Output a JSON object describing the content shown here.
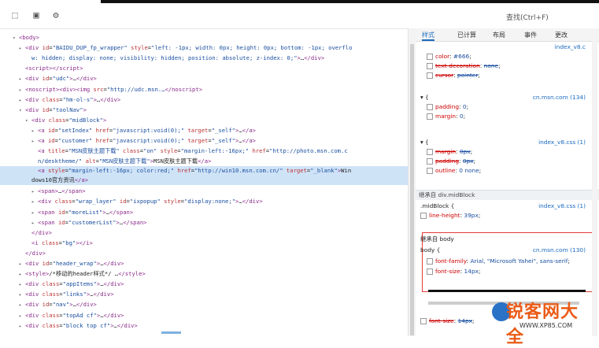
{
  "toolbar": {
    "search_placeholder": "查找(Ctrl+F)",
    "icons": [
      "inspect-icon",
      "console-toggle-icon",
      "settings-icon"
    ]
  },
  "dom_lines": [
    {
      "indent": 2,
      "t": "▾",
      "html": "<span class='tag'>&lt;body&gt;</span>"
    },
    {
      "indent": 3,
      "t": "▸",
      "html": "<span class='tag'>&lt;div</span> <span class='attr'>id</span>=<span class='val'>\"BAIDU_DUP_fp_wrapper\"</span> <span class='attr'>style</span>=<span class='val'>\"left: -1px; width: 0px; height: 0px; bottom: -1px; overflo</span>"
    },
    {
      "indent": 4,
      "t": "",
      "html": "<span class='val'>w: hidden; display: none; visibility: hidden; position: absolute; z-index: 0;\"</span><span class='tag'>&gt;</span>…<span class='tag'>&lt;/div&gt;</span>"
    },
    {
      "indent": 3,
      "t": "",
      "html": "<span class='tag'>&lt;script&gt;&lt;/script&gt;</span>"
    },
    {
      "indent": 3,
      "t": "▸",
      "html": "<span class='tag'>&lt;div</span> <span class='attr'>id</span>=<span class='val'>\"udc\"</span><span class='tag'>&gt;</span>…<span class='tag'>&lt;/div&gt;</span>"
    },
    {
      "indent": 3,
      "t": "▸",
      "html": "<span class='tag'>&lt;noscript&gt;&lt;div&gt;&lt;img</span> <span class='attr'>src</span>=<span class='val'>\"http://udc.msn.…</span><span class='tag'>&lt;/noscript&gt;</span>"
    },
    {
      "indent": 3,
      "t": "▸",
      "html": "<span class='tag'>&lt;div</span> <span class='attr'>class</span>=<span class='val'>\"hm-ol-s\"</span><span class='tag'>&gt;</span>…<span class='tag'>&lt;/div&gt;</span>"
    },
    {
      "indent": 3,
      "t": "▾",
      "html": "<span class='tag'>&lt;div</span> <span class='attr'>id</span>=<span class='val'>\"toolNav\"</span><span class='tag'>&gt;</span>"
    },
    {
      "indent": 4,
      "t": "▾",
      "html": "<span class='tag'>&lt;div</span> <span class='attr'>class</span>=<span class='val'>\"midBlock\"</span><span class='tag'>&gt;</span>"
    },
    {
      "indent": 5,
      "t": "▸",
      "html": "<span class='tag'>&lt;a</span> <span class='attr'>id</span>=<span class='val'>\"setIndex\"</span> <span class='attr'>href</span>=<span class='val'>\"javascript:void(0);\"</span> <span class='attr'>target</span>=<span class='val'>\"_self\"</span><span class='tag'>&gt;</span>…<span class='tag'>&lt;/a&gt;</span>"
    },
    {
      "indent": 5,
      "t": "▸",
      "html": "<span class='tag'>&lt;a</span> <span class='attr'>id</span>=<span class='val'>\"customer\"</span> <span class='attr'>href</span>=<span class='val'>\"javascript:void(0);\"</span> <span class='attr'>target</span>=<span class='val'>\"_self\"</span><span class='tag'>&gt;</span>…<span class='tag'>&lt;/a&gt;</span>"
    },
    {
      "indent": 5,
      "t": "",
      "html": "<span class='tag'>&lt;a</span> <span class='attr'>title</span>=<span class='val'>\"MSN皮肤主题下载\"</span> <span class='attr'>class</span>=<span class='val'>\"on\"</span> <span class='attr'>style</span>=<span class='val'>\"margin-left:-16px;\"</span> <span class='attr'>href</span>=<span class='val'>\"http://photo.msn.com.c</span>"
    },
    {
      "indent": 5,
      "t": "",
      "html": "<span class='val'>n/desktheme/\"</span> <span class='attr'>alt</span>=<span class='val'>\"MSN皮肤主题下载\"</span><span class='tag'>&gt;</span>MSN皮肤主题下载<span class='tag'>&lt;/a&gt;</span>"
    },
    {
      "indent": 5,
      "t": "",
      "sel": true,
      "html": "<span class='tag'>&lt;a</span> <span class='attr'>style</span>=<span class='val'>\"margin-left:-16px; color:red;\"</span> <span class='attr'>href</span>=<span class='val'>\"http://win10.msn.com.cn/\"</span> <span class='attr'>target</span>=<span class='val'>\"_blank\"</span><span class='tag'>&gt;</span>Win<br>dows10官方资讯<span class='tag'>&lt;/a&gt;</span>"
    },
    {
      "indent": 5,
      "t": "▸",
      "html": "<span class='tag'>&lt;span&gt;</span>…<span class='tag'>&lt;/span&gt;</span>"
    },
    {
      "indent": 5,
      "t": "▸",
      "html": "<span class='tag'>&lt;div</span> <span class='attr'>class</span>=<span class='val'>\"wrap_layer\"</span> <span class='attr'>id</span>=<span class='val'>\"ixpopup\"</span> <span class='attr'>style</span>=<span class='val'>\"display:none;\"</span><span class='tag'>&gt;</span>…<span class='tag'>&lt;/div&gt;</span>"
    },
    {
      "indent": 5,
      "t": "▸",
      "html": "<span class='tag'>&lt;span</span> <span class='attr'>id</span>=<span class='val'>\"moreList\"</span><span class='tag'>&gt;</span>…<span class='tag'>&lt;/span&gt;</span>"
    },
    {
      "indent": 5,
      "t": "▸",
      "html": "<span class='tag'>&lt;span</span> <span class='attr'>id</span>=<span class='val'>\"customerList\"</span><span class='tag'>&gt;</span>…<span class='tag'>&lt;/span&gt;</span>"
    },
    {
      "indent": 4,
      "t": "",
      "html": "<span class='tag'>&lt;/div&gt;</span>"
    },
    {
      "indent": 4,
      "t": "",
      "html": "<span class='tag'>&lt;i</span> <span class='attr'>class</span>=<span class='val'>\"bg\"</span><span class='tag'>&gt;&lt;/i&gt;</span>"
    },
    {
      "indent": 3,
      "t": "",
      "html": "<span class='tag'>&lt;/div&gt;</span>"
    },
    {
      "indent": 3,
      "t": "▸",
      "html": "<span class='tag'>&lt;div</span> <span class='attr'>id</span>=<span class='val'>\"header_wrap\"</span><span class='tag'>&gt;</span>…<span class='tag'>&lt;/div&gt;</span>"
    },
    {
      "indent": 3,
      "t": "▸",
      "html": "<span class='tag'>&lt;style&gt;</span>/*移动的header样式*/ …<span class='tag'>&lt;/style&gt;</span>"
    },
    {
      "indent": 3,
      "t": "▸",
      "html": "<span class='tag'>&lt;div</span> <span class='attr'>class</span>=<span class='val'>\"appItems\"</span><span class='tag'>&gt;</span>…<span class='tag'>&lt;/div&gt;</span>"
    },
    {
      "indent": 3,
      "t": "▸",
      "html": "<span class='tag'>&lt;div</span> <span class='attr'>class</span>=<span class='val'>\"links\"</span><span class='tag'>&gt;</span>…<span class='tag'>&lt;/div&gt;</span>"
    },
    {
      "indent": 3,
      "t": "▸",
      "html": "<span class='tag'>&lt;div</span> <span class='attr'>id</span>=<span class='val'>\"nav\"</span><span class='tag'>&gt;</span>…<span class='tag'>&lt;/div&gt;</span>"
    },
    {
      "indent": 3,
      "t": "▸",
      "html": "<span class='tag'>&lt;div</span> <span class='attr'>class</span>=<span class='val'>\"topAd cf\"</span><span class='tag'>&gt;</span>…<span class='tag'>&lt;/div&gt;</span>"
    },
    {
      "indent": 3,
      "t": "▸",
      "html": "<span class='tag'>&lt;div</span> <span class='attr'>class</span>=<span class='val'>\"block top cf\"</span><span class='tag'>&gt;</span>…<span class='tag'>&lt;/div&gt;</span>"
    }
  ],
  "tabs": [
    {
      "label": "样式",
      "active": true
    },
    {
      "label": "已计算",
      "active": false
    },
    {
      "label": "布局",
      "active": false
    },
    {
      "label": "事件",
      "active": false
    },
    {
      "label": "更改",
      "active": false
    }
  ],
  "styles": {
    "top_link": "index_v8.c",
    "aa": "a:",
    "rule1": [
      {
        "prop": "color",
        "val": "#666",
        "strike": false
      },
      {
        "prop": "text-decoration",
        "val": "none",
        "strike": true
      },
      {
        "prop": "cursor",
        "val": "pointer",
        "strike": true
      }
    ],
    "rule2_link": "cn.msn.com (134)",
    "rule2": [
      {
        "prop": "padding",
        "val": "0",
        "strike": false
      },
      {
        "prop": "margin",
        "val": "0",
        "strike": false
      }
    ],
    "rule3_link": "index_v8.css (1)",
    "rule3": [
      {
        "prop": "margin",
        "val": "0px",
        "strike": true
      },
      {
        "prop": "padding",
        "val": "0px",
        "strike": true
      },
      {
        "prop": "outline",
        "val": "0 none",
        "strike": false
      }
    ],
    "inherit1_label": "继承自 div.midBlock",
    "midblock_selector": ".midBlock {",
    "midblock_link": "index_v8.css (1)",
    "midblock_prop": {
      "prop": "line-height",
      "val": "39px"
    },
    "inherit2_label": "继承自 body",
    "body_selector": "body {",
    "body_link": "cn.msn.com (130)",
    "body_props": [
      {
        "prop": "font-family",
        "val": "Arial, \"Microsoft Yahei\", sans-serif"
      },
      {
        "prop": "font-size",
        "val": "14px"
      }
    ],
    "bottom_prop": {
      "prop": "font-size",
      "val": "14px"
    }
  },
  "watermark": {
    "text": "锐客网大全",
    "url": "WWW.XP85.COM"
  }
}
